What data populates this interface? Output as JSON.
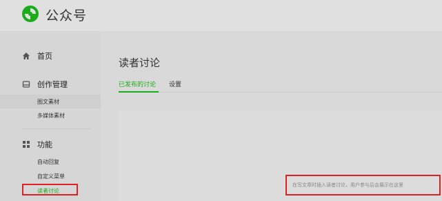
{
  "header": {
    "app_name": "公众号",
    "logo_icon": "wechat-official-account-logo-icon",
    "brand_color": "#1aad19"
  },
  "sidebar": {
    "home": {
      "label": "首页",
      "icon": "home-icon"
    },
    "content": {
      "label": "创作管理",
      "icon": "inbox-icon",
      "items": [
        "图文素材",
        "多媒体素材"
      ]
    },
    "features": {
      "label": "功能",
      "icon": "grid-icon",
      "items": [
        "自动回复",
        "自定义菜单",
        "读者讨论"
      ]
    }
  },
  "main": {
    "title": "读者讨论",
    "tabs": [
      {
        "label": "已发布的讨论",
        "active": true
      },
      {
        "label": "设置",
        "active": false
      }
    ],
    "empty_notice": "在写文章时插入读者讨论，用户参与后会展示在这里"
  },
  "colors": {
    "highlight": "#e02020",
    "active": "#1aad19"
  }
}
